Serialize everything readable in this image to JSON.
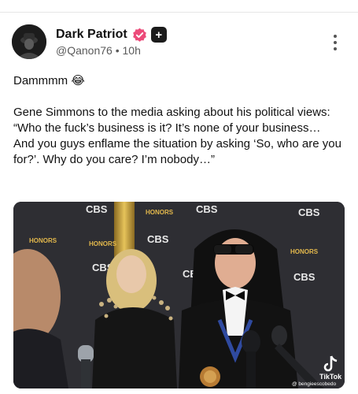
{
  "post": {
    "author": {
      "display_name": "Dark Patriot",
      "handle": "@Qanon76",
      "separator": "•",
      "time": "10h",
      "verified_color": "#ec4b7a",
      "badge_glyph": "+"
    },
    "text": {
      "line1": "Dammmm 😂",
      "body": "Gene Simmons to the media asking about his political views: “Who the fuck’s business is it? It’s none of your business… And you guys enflame the situation by asking ‘So, who are you for?’. Why do you care? I’m nobody…”"
    },
    "media": {
      "backdrop_brands": [
        "CBS",
        "CBS",
        "CBS",
        "CBS",
        "CBS",
        "CBS",
        "CBS"
      ],
      "honors_text": "HONORS",
      "watermark_brand": "TikTok",
      "watermark_user": "@ bengieescobedo"
    }
  }
}
